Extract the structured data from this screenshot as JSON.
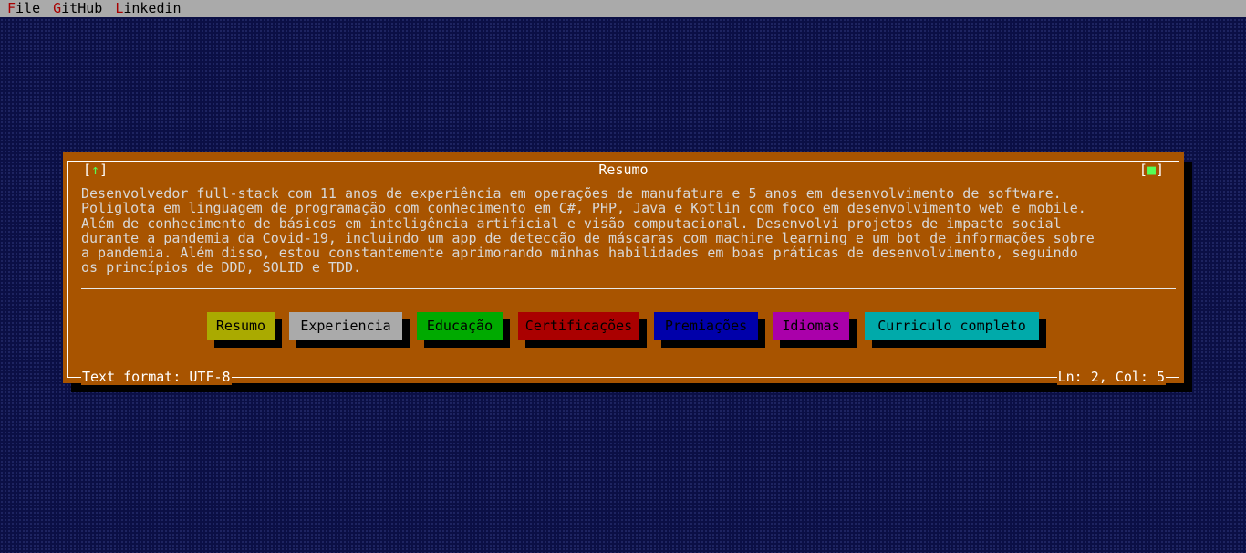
{
  "menu": {
    "items": [
      {
        "hotkey": "F",
        "rest": "ile"
      },
      {
        "hotkey": "G",
        "rest": "itHub"
      },
      {
        "hotkey": "L",
        "rest": "inkedin"
      }
    ]
  },
  "window": {
    "title": "Resumo",
    "close_button": {
      "left": "[",
      "icon": "↑",
      "right": "]"
    },
    "zoom_button": {
      "left": "[",
      "icon": "■",
      "right": "]"
    },
    "content_lines": [
      "Desenvolvedor full-stack com 11 anos de experiência em operações de manufatura e 5 anos em desenvolvimento de software.",
      "Poliglota em linguagem de programação com conhecimento em C#, PHP, Java e Kotlin com foco em desenvolvimento web e mobile.",
      "Além de conhecimento de básicos em inteligência artificial e visão computacional. Desenvolvi projetos de impacto social",
      "durante a pandemia da Covid-19, incluindo um app de detecção de máscaras com machine learning e um bot de informações sobre",
      "a pandemia. Além disso, estou constantemente aprimorando minhas habilidades em boas práticas de desenvolvimento, seguindo",
      "os princípios de DDD, SOLID e TDD."
    ],
    "buttons": [
      {
        "label": "Resumo",
        "color": "#aaaa00",
        "text_color": "#000000"
      },
      {
        "label": "Experiencia",
        "color": "#aaaaaa",
        "text_color": "#000000"
      },
      {
        "label": "Educação",
        "color": "#00aa00",
        "text_color": "#000000"
      },
      {
        "label": "Certificações",
        "color": "#aa0000",
        "text_color": "#000000"
      },
      {
        "label": "Premiações",
        "color": "#0000aa",
        "text_color": "#000000"
      },
      {
        "label": "Idiomas",
        "color": "#aa00aa",
        "text_color": "#000000"
      },
      {
        "label": "Curriculo completo",
        "color": "#00aaaa",
        "text_color": "#000000"
      }
    ],
    "status_left": "Text format: UTF-8",
    "status_right": "Ln: 2, Col: 5"
  },
  "colors": {
    "desktop": "#0b0f45",
    "menubar": "#aaaaaa",
    "window": "#a85400",
    "hotkey": "#a80000",
    "accent_green": "#55ff55"
  }
}
